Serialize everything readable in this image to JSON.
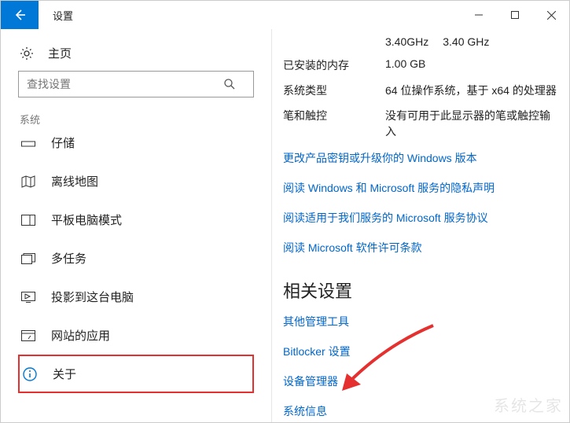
{
  "window": {
    "title": "设置"
  },
  "sidebar": {
    "home": "主页",
    "search_placeholder": "查找设置",
    "group": "系统",
    "items": [
      {
        "label": "仔储"
      },
      {
        "label": "离线地图"
      },
      {
        "label": "平板电脑模式"
      },
      {
        "label": "多任务"
      },
      {
        "label": "投影到这台电脑"
      },
      {
        "label": "网站的应用"
      },
      {
        "label": "关于"
      }
    ]
  },
  "specs": {
    "freq1": "3.40GHz",
    "freq2": "3.40 GHz",
    "ram_label": "已安装的内存",
    "ram_value": "1.00 GB",
    "systype_label": "系统类型",
    "systype_value": "64 位操作系统，基于 x64 的处理器",
    "pen_label": "笔和触控",
    "pen_value": "没有可用于此显示器的笔或触控输入"
  },
  "links": [
    "更改产品密钥或升级你的 Windows 版本",
    "阅读 Windows 和 Microsoft 服务的隐私声明",
    "阅读适用于我们服务的 Microsoft 服务协议",
    "阅读 Microsoft 软件许可条款"
  ],
  "related": {
    "heading": "相关设置",
    "links": [
      "其他管理工具",
      "Bitlocker 设置",
      "设备管理器",
      "系统信息"
    ]
  },
  "watermark": "系统之家"
}
